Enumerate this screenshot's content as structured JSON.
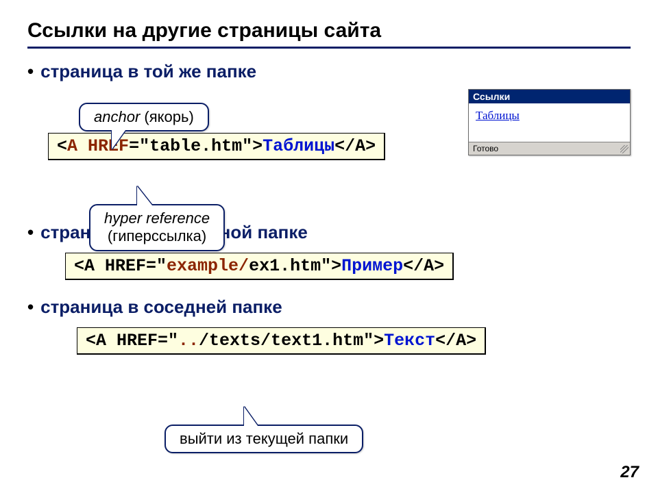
{
  "title": "Ссылки на другие страницы сайта",
  "pageNumber": "27",
  "bullets": {
    "same": "страница в той же папке",
    "sub": "страница во вложенной папке",
    "sib": "страница в соседней папке"
  },
  "callouts": {
    "anchor_it": "anchor",
    "anchor_rest": " (якорь)",
    "href_it": "hyper reference",
    "href_rest": "(гиперссылка)",
    "dotdot": "выйти из текущей папки"
  },
  "code1": {
    "lt": "<",
    "a": "A",
    "sp": " ",
    "href": "HREF",
    "eqq": "=\"table.htm\">",
    "link": "Таблицы",
    "close": "</A>"
  },
  "code2": {
    "pre": "<A HREF=\"",
    "folder": "example/",
    "rest": "ex1.htm\">",
    "link": "Пример",
    "close": "</A>"
  },
  "code3": {
    "pre": "<A HREF=\"",
    "dots": "..",
    "rest": "/texts/text1.htm\">",
    "link": "Текст",
    "close": "</A>"
  },
  "browser": {
    "title": "Ссылки",
    "link": "Таблицы",
    "status": "Готово"
  }
}
